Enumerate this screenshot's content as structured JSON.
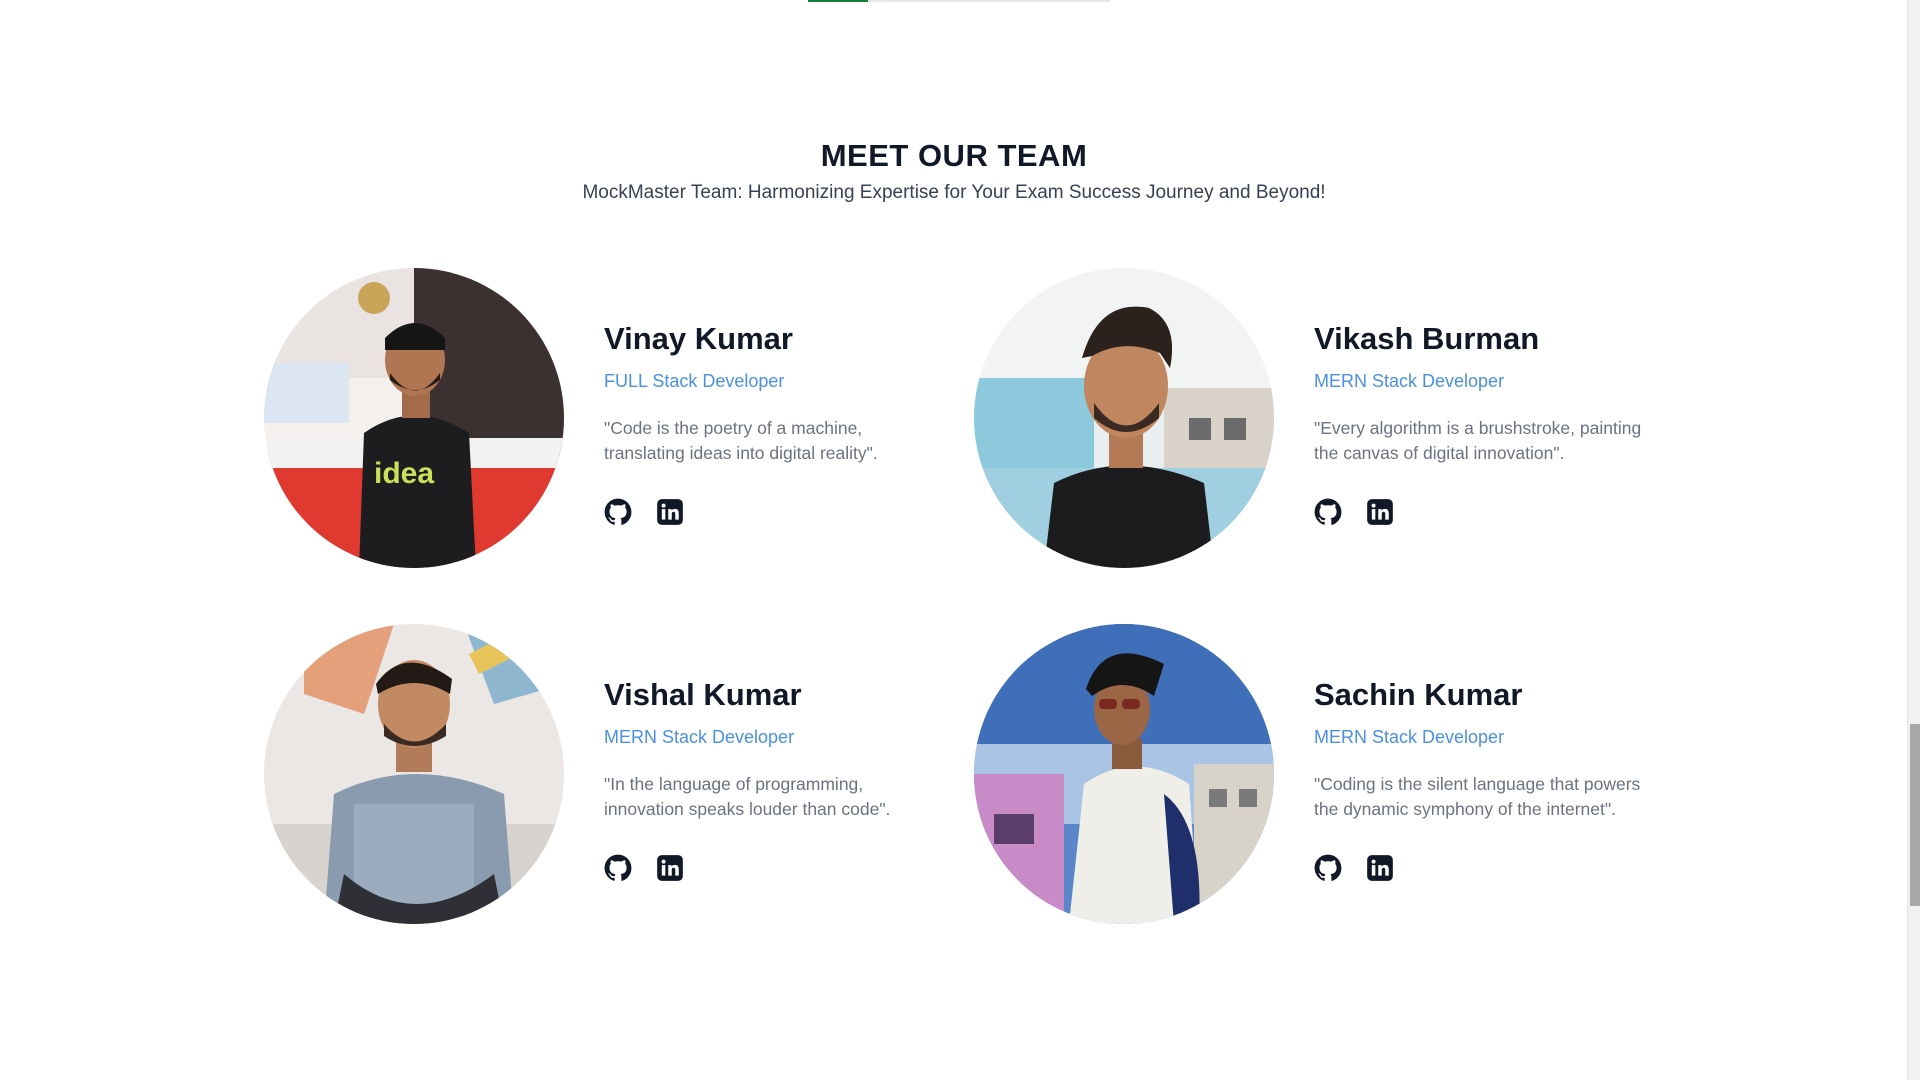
{
  "page": {
    "progress_fraction": 0.2
  },
  "section": {
    "title": "MEET OUR TEAM",
    "subtitle": "MockMaster Team: Harmonizing Expertise for Your Exam Success Journey and Beyond!"
  },
  "team": [
    {
      "name": "Vinay Kumar",
      "role": "FULL Stack Developer",
      "quote": "\"Code is the poetry of a machine, translating ideas into digital reality\".",
      "icons": [
        "github-icon",
        "linkedin-icon"
      ]
    },
    {
      "name": "Vikash Burman",
      "role": "MERN Stack Developer",
      "quote": "\"Every algorithm is a brushstroke, painting the canvas of digital innovation\".",
      "icons": [
        "github-icon",
        "linkedin-icon"
      ]
    },
    {
      "name": "Vishal Kumar",
      "role": "MERN Stack Developer",
      "quote": "\"In the language of programming, innovation speaks louder than code\".",
      "icons": [
        "github-icon",
        "linkedin-icon"
      ]
    },
    {
      "name": "Sachin Kumar",
      "role": "MERN Stack Developer",
      "quote": "\"Coding is the silent language that powers the dynamic symphony of the internet\".",
      "icons": [
        "github-icon",
        "linkedin-icon"
      ]
    }
  ],
  "colors": {
    "accent_progress": "#15803d",
    "role_text": "#4a90e2",
    "heading": "#111827",
    "quote_text": "#6b7280"
  }
}
